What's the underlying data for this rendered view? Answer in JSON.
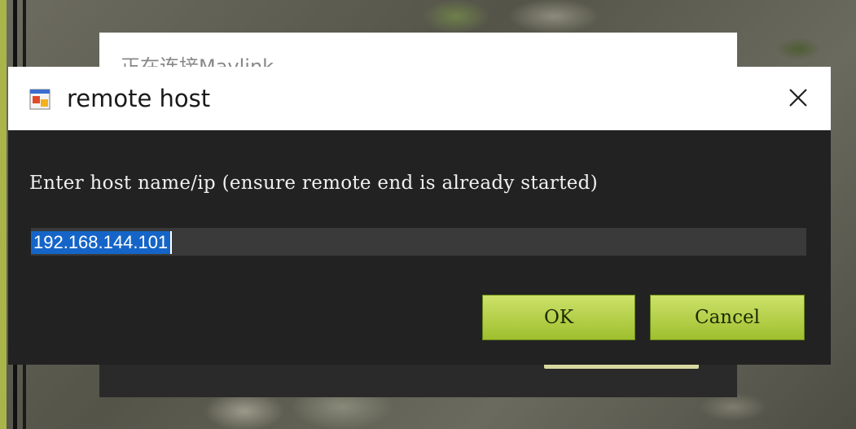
{
  "background_window": {
    "title": "正在连接Mavlink"
  },
  "dialog": {
    "title": "remote host",
    "icon": "app-window-icon",
    "close_icon": "close-icon",
    "prompt": "Enter host name/ip (ensure remote end is already started)",
    "host_value": "192.168.144.101",
    "ok_label": "OK",
    "cancel_label": "Cancel"
  },
  "colors": {
    "button_gradient_top": "#cde26a",
    "button_gradient_bottom": "#9fbf2e",
    "selection": "#1565c8",
    "dialog_body": "#222222"
  }
}
